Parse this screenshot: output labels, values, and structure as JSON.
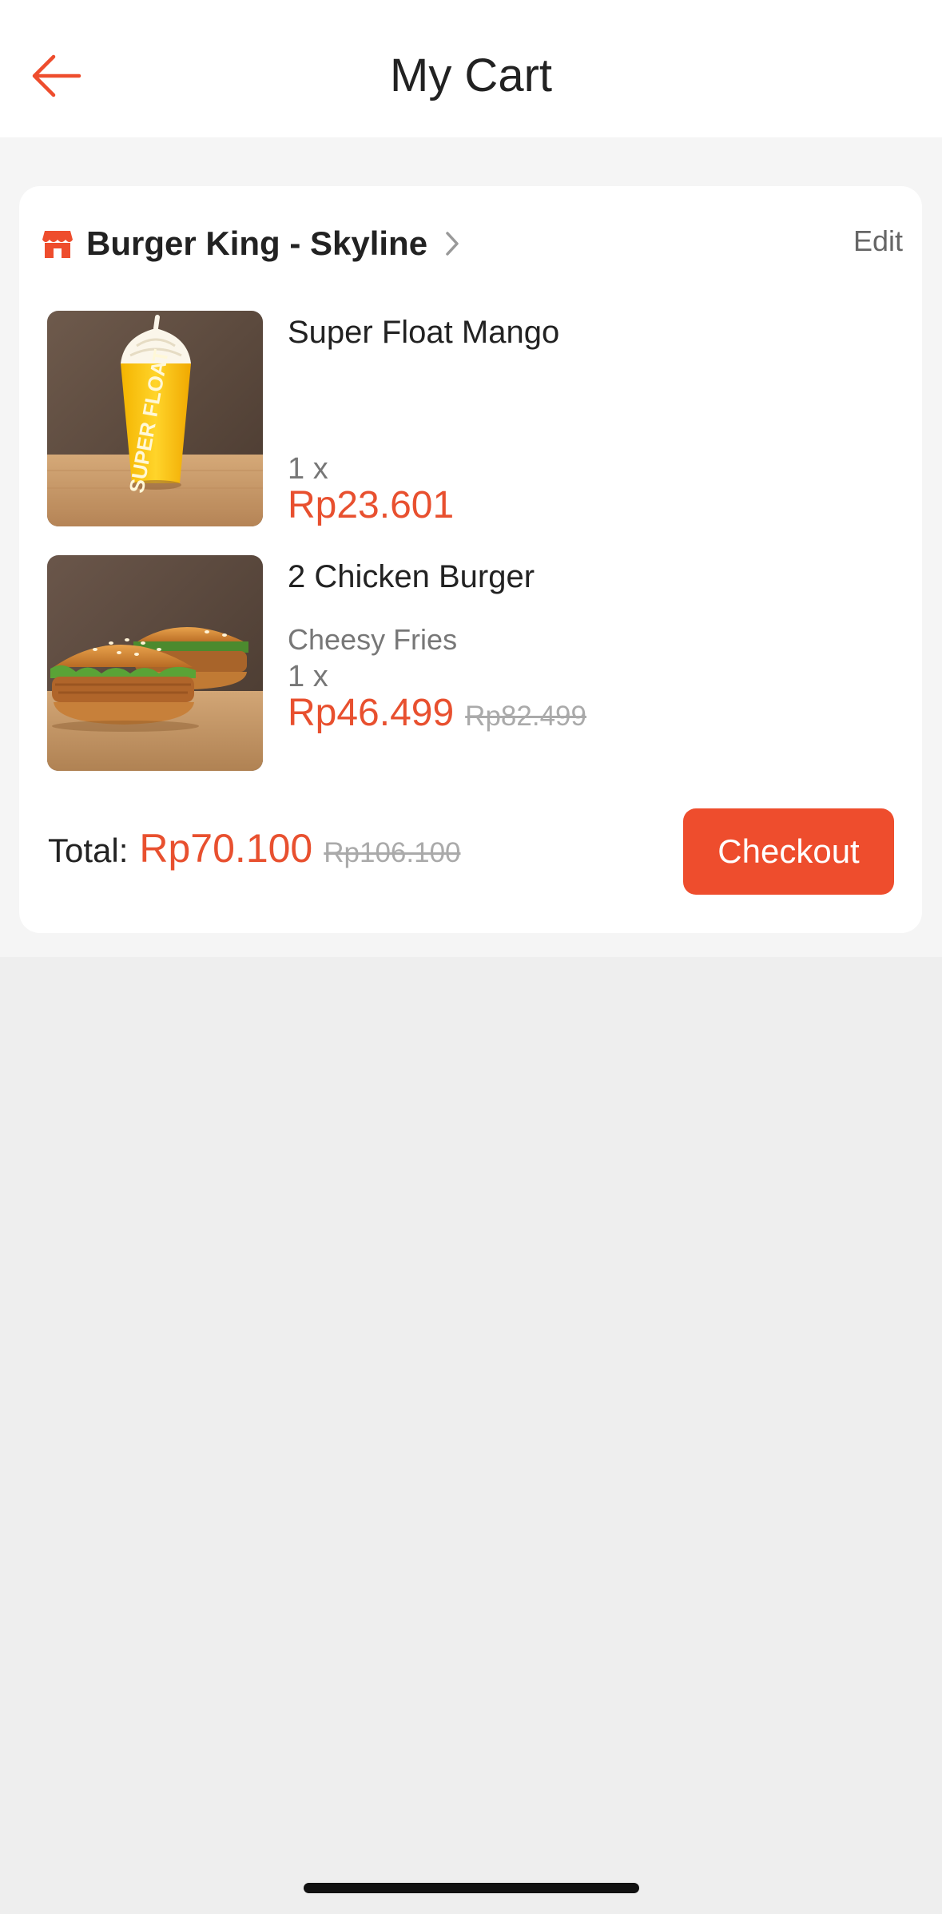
{
  "header": {
    "title": "My Cart",
    "back_icon": "arrow-left-icon"
  },
  "shop": {
    "name": "Burger King - Skyline",
    "icon": "store-icon",
    "edit_label": "Edit"
  },
  "items": [
    {
      "name": "Super Float Mango",
      "variant": "",
      "quantity": "1 x",
      "price": "Rp23.601",
      "original_price": ""
    },
    {
      "name": "2 Chicken Burger",
      "variant": "Cheesy Fries",
      "quantity": "1 x",
      "price": "Rp46.499",
      "original_price": "Rp82.499"
    }
  ],
  "summary": {
    "total_label": "Total:",
    "total": "Rp70.100",
    "original_total": "Rp106.100",
    "checkout_label": "Checkout"
  },
  "colors": {
    "accent": "#ee4d2d",
    "price": "#e8502f",
    "background": "#eeeeee"
  }
}
